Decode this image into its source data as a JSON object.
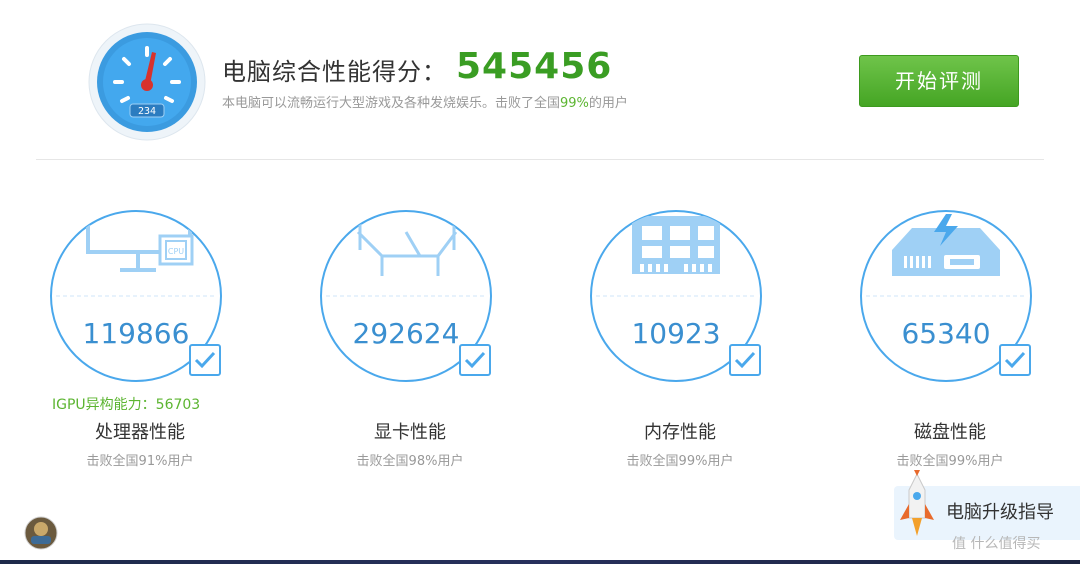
{
  "header": {
    "gauge_digits": "234",
    "title": "电脑综合性能得分：",
    "score": "545456",
    "subtitle_before": "本电脑可以流畅运行大型游戏及各种发烧娱乐。击败了全国",
    "subtitle_pct": "99%",
    "subtitle_after": "的用户",
    "start_button": "开始评测"
  },
  "cards": [
    {
      "icon": "monitor-cpu-icon",
      "score": "119866",
      "label": "处理器性能",
      "sub": "击败全国91%用户"
    },
    {
      "icon": "graphics-card-icon",
      "score": "292624",
      "label": "显卡性能",
      "sub": "击败全国98%用户"
    },
    {
      "icon": "memory-module-icon",
      "score": "10923",
      "label": "内存性能",
      "sub": "击败全国99%用户"
    },
    {
      "icon": "disk-drive-icon",
      "score": "65340",
      "label": "磁盘性能",
      "sub": "击败全国99%用户"
    }
  ],
  "igpu": "IGPU异构能力：56703",
  "upgrade_label": "电脑升级指导",
  "watermark": "值 什么值得买",
  "colors": {
    "accent_blue": "#3a8fd0",
    "ring": "#4aa8ec",
    "green": "#3a9d23",
    "button_green": "#56b432"
  }
}
